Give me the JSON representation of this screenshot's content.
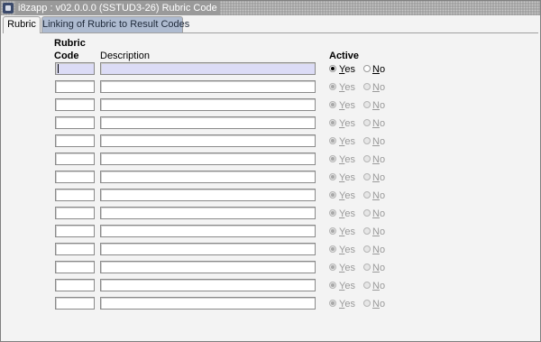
{
  "window": {
    "title": "i8zapp : v02.0.0.0 (SSTUD3-26) Rubric Code"
  },
  "tabs": [
    {
      "label": "Rubric",
      "active": true
    },
    {
      "label": "Linking of Rubric to Result Codes",
      "active": false
    }
  ],
  "headers": {
    "code_line1": "Rubric",
    "code_line2": "Code",
    "description": "Description",
    "active": "Active"
  },
  "radio": {
    "yes_first": "Y",
    "yes_rest": "es",
    "no_first": "N",
    "no_rest": "o"
  },
  "rows": [
    {
      "code": "",
      "description": "",
      "active": "Yes"
    },
    {
      "code": "",
      "description": "",
      "active": "Yes"
    },
    {
      "code": "",
      "description": "",
      "active": "Yes"
    },
    {
      "code": "",
      "description": "",
      "active": "Yes"
    },
    {
      "code": "",
      "description": "",
      "active": "Yes"
    },
    {
      "code": "",
      "description": "",
      "active": "Yes"
    },
    {
      "code": "",
      "description": "",
      "active": "Yes"
    },
    {
      "code": "",
      "description": "",
      "active": "Yes"
    },
    {
      "code": "",
      "description": "",
      "active": "Yes"
    },
    {
      "code": "",
      "description": "",
      "active": "Yes"
    },
    {
      "code": "",
      "description": "",
      "active": "Yes"
    },
    {
      "code": "",
      "description": "",
      "active": "Yes"
    },
    {
      "code": "",
      "description": "",
      "active": "Yes"
    },
    {
      "code": "",
      "description": "",
      "active": "Yes"
    }
  ],
  "colors": {
    "current_row_field": "#dcdcf6",
    "inactive_tab": "#aebbd0",
    "titlebar": "#9a9a9a"
  }
}
